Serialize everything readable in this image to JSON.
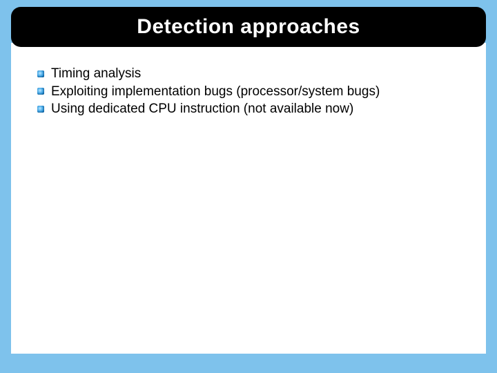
{
  "title": "Detection approaches",
  "bullets": [
    "Timing analysis",
    "Exploiting implementation bugs (processor/system bugs)",
    "Using dedicated CPU instruction (not available now)"
  ]
}
